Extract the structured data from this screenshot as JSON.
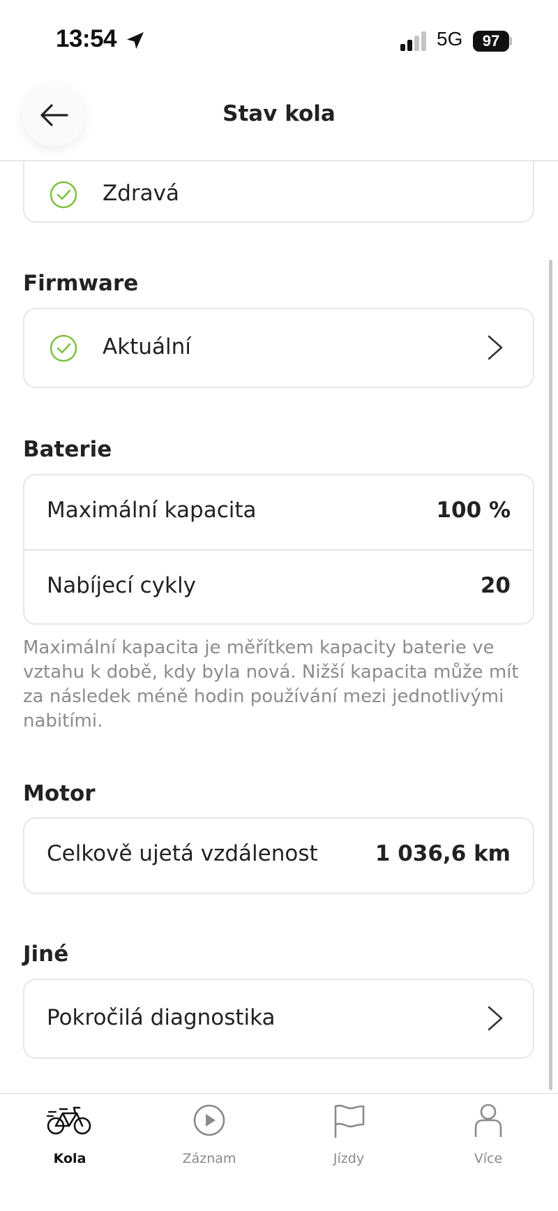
{
  "status_bar": {
    "time": "13:54",
    "network": "5G",
    "battery": "97"
  },
  "header": {
    "title": "Stav kola"
  },
  "health": {
    "status": "Zdravá"
  },
  "firmware": {
    "section_title": "Firmware",
    "status": "Aktuální"
  },
  "battery_section": {
    "section_title": "Baterie",
    "rows": [
      {
        "label": "Maximální kapacita",
        "value": "100 %"
      },
      {
        "label": "Nabíjecí cykly",
        "value": "20"
      }
    ],
    "note": "Maximální kapacita je měřítkem kapacity baterie ve vztahu k době, kdy byla nová. Nižší kapacita může mít za následek méně hodin používání mezi jednotlivými nabitími."
  },
  "motor": {
    "section_title": "Motor",
    "rows": [
      {
        "label": "Celkově ujetá vzdálenost",
        "value": "1 036,6 km"
      }
    ]
  },
  "other": {
    "section_title": "Jiné",
    "item": "Pokročilá diagnostika"
  },
  "tabs": [
    {
      "label": "Kola",
      "icon": "bike-icon",
      "active": true
    },
    {
      "label": "Záznam",
      "icon": "play-icon",
      "active": false
    },
    {
      "label": "Jízdy",
      "icon": "flag-icon",
      "active": false
    },
    {
      "label": "Více",
      "icon": "person-icon",
      "active": false
    }
  ],
  "colors": {
    "accent_green": "#7cc142",
    "text": "#222222",
    "muted": "#8c8c8c"
  }
}
